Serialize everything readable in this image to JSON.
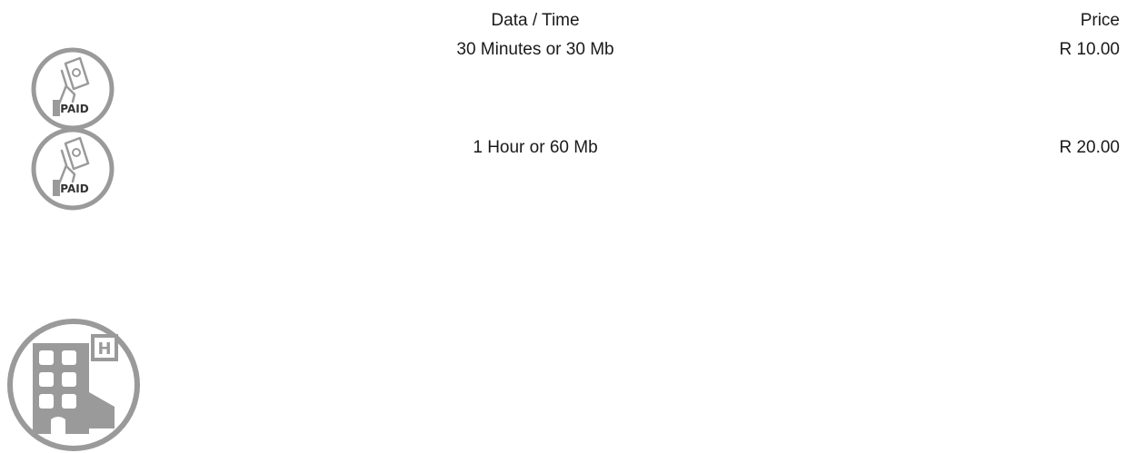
{
  "table": {
    "headers": {
      "data_time": "Data / Time",
      "price": "Price"
    },
    "rows": [
      {
        "icon": "paid-icon",
        "icon_text": "PAID",
        "plan": "30 Minutes or 30 Mb",
        "price": "R 10.00"
      },
      {
        "icon": "paid-icon",
        "icon_text": "PAID",
        "plan": "1 Hour or 60 Mb",
        "price": "R 20.00"
      }
    ]
  },
  "footer": {
    "icon": "hotel-icon",
    "icon_text": "H"
  },
  "colors": {
    "icon_gray": "#9a9a9a",
    "text": "#1a1a1a",
    "background": "#ffffff"
  }
}
